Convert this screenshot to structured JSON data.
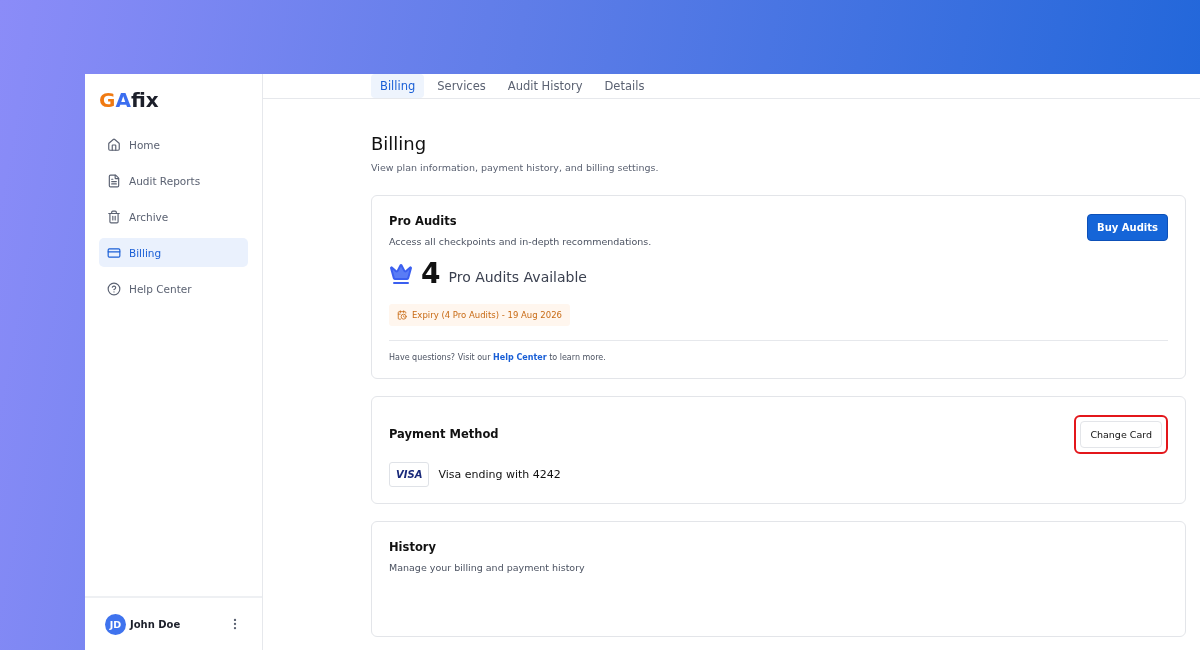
{
  "logo": {
    "mark": "GA",
    "name": "fix"
  },
  "sidebar": {
    "items": [
      {
        "label": "Home",
        "selected": false
      },
      {
        "label": "Audit Reports",
        "selected": false
      },
      {
        "label": "Archive",
        "selected": false
      },
      {
        "label": "Billing",
        "selected": true
      },
      {
        "label": "Help Center",
        "selected": false
      }
    ]
  },
  "user": {
    "initials": "JD",
    "name": "John Doe"
  },
  "tabs": [
    {
      "label": "Billing",
      "selected": true
    },
    {
      "label": "Services",
      "selected": false
    },
    {
      "label": "Audit History",
      "selected": false
    },
    {
      "label": "Details",
      "selected": false
    }
  ],
  "page": {
    "title": "Billing",
    "subtitle": "View plan information, payment history, and billing settings."
  },
  "pro_audits": {
    "title": "Pro Audits",
    "description": "Access all checkpoints and in-depth recommendations.",
    "button": "Buy Audits",
    "count": "4",
    "count_label": "Pro Audits Available",
    "expiry": "Expiry (4 Pro Audits) - 19 Aug 2026",
    "help_before": "Have questions? Visit our",
    "help_link": "Help Center",
    "help_after": "to learn more."
  },
  "payment": {
    "title": "Payment Method",
    "button": "Change Card",
    "button_highlighted": true,
    "card_brand": "VISA",
    "card_text": "Visa ending with 4242"
  },
  "history": {
    "title": "History",
    "description": "Manage your billing and payment history"
  }
}
